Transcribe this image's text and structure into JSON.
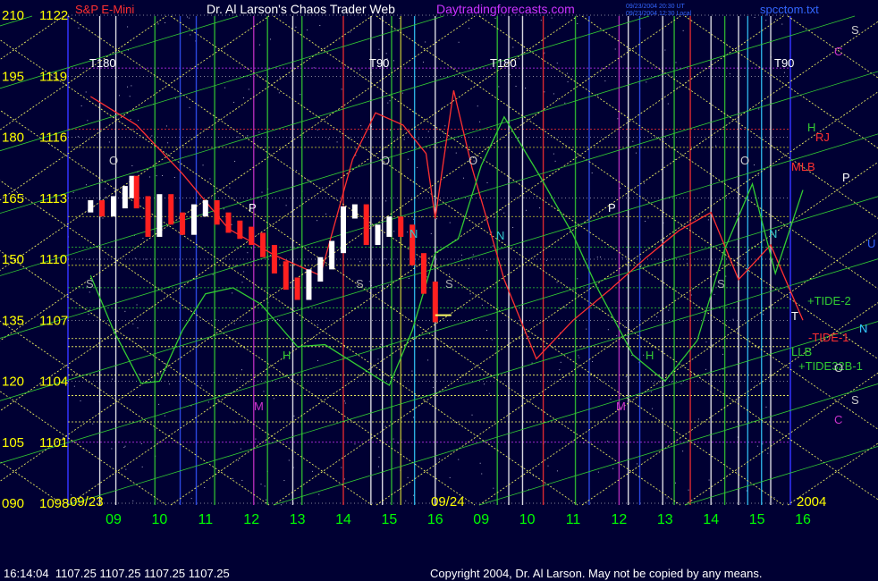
{
  "header": {
    "instrument": "S&P E-Mini",
    "title": "Dr. Al Larson's Chaos Trader Web",
    "site": "Daytradingforecasts.com",
    "stamp_1": "09/23/2004 20:30 UT",
    "stamp_2": "09/23/2004 12:30 Local",
    "file": "spcctom.txt"
  },
  "footer": {
    "quote": "16:14:04  1107.25 1107.25 1107.25 1107.25",
    "copyright": "Copyright 2004, Dr. Al Larson. May not be copied by any means."
  },
  "colors": {
    "background": "#000033",
    "price_up": "#ffffff",
    "price_down": "#ff2020",
    "red_line": "#ff3030",
    "green_line": "#33cc33",
    "yellow_grid": "#ffff66",
    "hour_labels": "#00ff00",
    "axis_text": "#ffff00"
  },
  "chart_data": {
    "type": "line",
    "y_labels": [
      {
        "left": "210",
        "right": "1122"
      },
      {
        "left": "195",
        "right": "1119"
      },
      {
        "left": "180",
        "right": "1116"
      },
      {
        "left": "165",
        "right": "1113"
      },
      {
        "left": "150",
        "right": "1110"
      },
      {
        "left": "135",
        "right": "1107"
      },
      {
        "left": "120",
        "right": "1104"
      },
      {
        "left": "105",
        "right": "1101"
      },
      {
        "left": "090",
        "right": "1098"
      }
    ],
    "ylim": [
      1098,
      1122
    ],
    "x_ticks": [
      "09",
      "10",
      "11",
      "12",
      "13",
      "14",
      "15",
      "16",
      "09",
      "10",
      "11",
      "12",
      "13",
      "14",
      "15",
      "16"
    ],
    "date_labels": [
      "09/23",
      "09/24",
      "2004"
    ],
    "price_series": {
      "name": "S&P E-Mini",
      "hours": [
        8.5,
        8.75,
        9,
        9.25,
        9.4,
        9.5,
        9.75,
        10,
        10.25,
        10.5,
        10.75,
        11,
        11.25,
        11.5,
        11.75,
        12,
        12.25,
        12.5,
        12.75,
        13,
        13.25,
        13.5,
        13.75,
        14,
        14.25,
        14.5,
        14.75,
        15,
        15.25,
        15.5,
        15.75,
        16
      ],
      "close": [
        1112.6,
        1112.4,
        1112.8,
        1113.3,
        1113.8,
        1112.8,
        1111.4,
        1112.9,
        1112.0,
        1111.5,
        1112.4,
        1112.6,
        1112.0,
        1111.6,
        1111.3,
        1111.0,
        1110.4,
        1109.6,
        1108.8,
        1108.3,
        1109.2,
        1109.8,
        1110.6,
        1112.3,
        1112.4,
        1111.0,
        1111.4,
        1111.8,
        1111.4,
        1110.0,
        1108.6,
        1107.2
      ],
      "last": 1107.25
    },
    "forecast_lines": [
      {
        "name": "red",
        "color": "#ff3030",
        "x": [
          8.5,
          9.5,
          10.5,
          11.5,
          12.5,
          13.5,
          14.2,
          14.7,
          15.3,
          15.8,
          16,
          16.4,
          16.8,
          17.5,
          18.2,
          19,
          19.8,
          20.6,
          21.3,
          22,
          22.6,
          23.3,
          24
        ],
        "y": [
          1118.0,
          1116.6,
          1114.2,
          1111.5,
          1110.2,
          1109.2,
          1114.9,
          1117.2,
          1116.6,
          1115.2,
          1112.0,
          1118.3,
          1114.5,
          1109.0,
          1105.1,
          1107.0,
          1108.5,
          1110.1,
          1111.4,
          1112.3,
          1109.0,
          1110.7,
          1107.0
        ]
      },
      {
        "name": "green",
        "color": "#33cc33",
        "x": [
          8.5,
          9,
          9.6,
          10,
          10.5,
          11,
          11.6,
          12.2,
          13,
          13.6,
          14.3,
          15,
          15.5,
          16,
          16.5,
          17,
          17.5,
          18.3,
          19,
          19.5,
          20.3,
          21,
          21.7,
          22.3,
          22.9,
          23.4,
          24
        ],
        "y": [
          1109.2,
          1106.5,
          1103.9,
          1104.0,
          1106.5,
          1108.3,
          1108.6,
          1107.8,
          1105.7,
          1105.8,
          1104.8,
          1103.8,
          1106.5,
          1110.3,
          1111.0,
          1114.6,
          1117.0,
          1114.0,
          1111.2,
          1108.7,
          1105.3,
          1104.0,
          1106.0,
          1110.5,
          1113.7,
          1109.3,
          1113.4
        ]
      }
    ],
    "cycle_labels": [
      "T180",
      "T90",
      "T180",
      "T90"
    ],
    "planet_marks": [
      "O",
      "O",
      "O",
      "O",
      "P",
      "P",
      "N",
      "N",
      "N",
      "S",
      "S",
      "S",
      "S",
      "M",
      "M",
      "H",
      "H"
    ],
    "right_labels": [
      {
        "text": "S",
        "color": "#cccccc"
      },
      {
        "text": "C",
        "color": "#cc33cc"
      },
      {
        "text": "H",
        "color": "#33cc33"
      },
      {
        "text": "RJ",
        "color": "#ff3030"
      },
      {
        "text": "MLB",
        "color": "#ff3030"
      },
      {
        "text": "P",
        "color": "#ffffff"
      },
      {
        "text": "U",
        "color": "#3366ff"
      },
      {
        "text": "+TIDE-2",
        "color": "#33cc33"
      },
      {
        "text": "N",
        "color": "#33ccff"
      },
      {
        "text": "T",
        "color": "#ffffff"
      },
      {
        "text": "-TIDE-1",
        "color": "#ff3030"
      },
      {
        "text": "LLB",
        "color": "#33cc33"
      },
      {
        "text": "+TIDE32B-1",
        "color": "#33cc33"
      },
      {
        "text": "O",
        "color": "#cccccc"
      },
      {
        "text": "S",
        "color": "#cccccc"
      },
      {
        "text": "C",
        "color": "#cc33cc"
      }
    ]
  }
}
